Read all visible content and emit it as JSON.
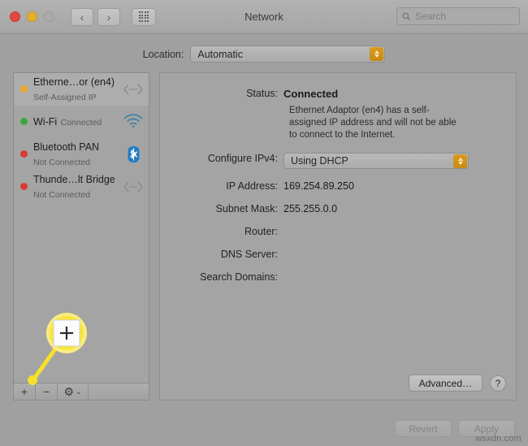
{
  "window": {
    "title": "Network",
    "traffic_lights": [
      "close-button",
      "minimize-button",
      "zoom-button"
    ],
    "back_label": "‹",
    "forward_label": "›",
    "grid_label": "show-all-grid-icon"
  },
  "search": {
    "placeholder": "Search",
    "value": ""
  },
  "location": {
    "label": "Location:",
    "value": "Automatic"
  },
  "sidebar": {
    "services": [
      {
        "name": "Etherne…or (en4)",
        "status": "Self-Assigned IP",
        "dot": "yellow",
        "icon": "ethernet-icon",
        "selected": true
      },
      {
        "name": "Wi-Fi",
        "status": "Connected",
        "dot": "green",
        "icon": "wifi-icon",
        "selected": false
      },
      {
        "name": "Bluetooth PAN",
        "status": "Not Connected",
        "dot": "red",
        "icon": "bluetooth-icon",
        "selected": false
      },
      {
        "name": "Thunde…lt Bridge",
        "status": "Not Connected",
        "dot": "red",
        "icon": "ethernet-icon",
        "selected": false
      }
    ],
    "toolbar": {
      "add_label": "+",
      "remove_label": "−",
      "gear_label": "⚙",
      "gear_chevron": "⌄"
    }
  },
  "detail": {
    "status_label": "Status:",
    "status_value": "Connected",
    "status_help": "Ethernet Adaptor (en4) has a self-assigned IP address and will not be able to connect to the Internet.",
    "configure_label": "Configure IPv4:",
    "configure_value": "Using DHCP",
    "fields": [
      {
        "label": "IP Address:",
        "value": "169.254.89.250"
      },
      {
        "label": "Subnet Mask:",
        "value": "255.255.0.0"
      },
      {
        "label": "Router:",
        "value": ""
      },
      {
        "label": "DNS Server:",
        "value": ""
      },
      {
        "label": "Search Domains:",
        "value": ""
      }
    ],
    "advanced_label": "Advanced…",
    "help_label": "?"
  },
  "footer": {
    "revert_label": "Revert",
    "apply_label": "Apply"
  },
  "callout": {
    "magnified_symbol": "+",
    "highlight_color": "#f5e02a"
  },
  "watermark": "wsxdn.com"
}
